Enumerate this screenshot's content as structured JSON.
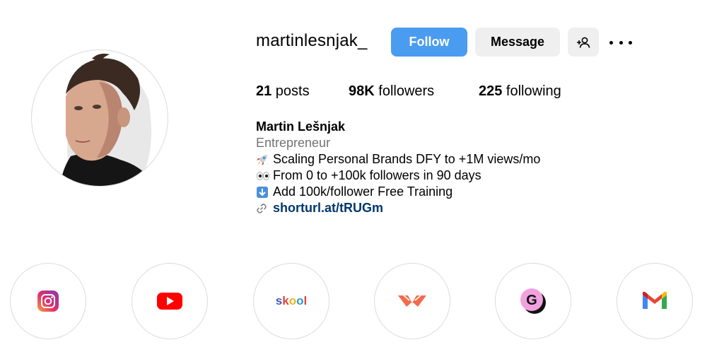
{
  "profile": {
    "username": "martinlesnjak_",
    "avatar_icon": "profile-photo"
  },
  "actions": {
    "follow_label": "Follow",
    "message_label": "Message",
    "add_user_icon": "add-user-icon",
    "more_icon": "more-options-icon"
  },
  "stats": {
    "posts_count": "21",
    "posts_label": " posts",
    "followers_count": "98K",
    "followers_label": " followers",
    "following_count": "225",
    "following_label": " following"
  },
  "bio": {
    "name": "Martin Lešnjak",
    "category": "Entrepreneur",
    "lines": [
      {
        "emoji": "rocket-emoji",
        "text": "Scaling Personal Brands DFY to +1M views/mo"
      },
      {
        "emoji": "eyes-emoji",
        "text": "From 0 to +100k followers in 90 days"
      },
      {
        "emoji": "down-arrow-emoji",
        "text": "Add 100k/follower Free Training"
      }
    ],
    "link": "shorturl.at/tRUGm"
  },
  "highlights": [
    {
      "icon": "instagram-icon"
    },
    {
      "icon": "youtube-icon"
    },
    {
      "icon": "skool-logo",
      "text": "skool"
    },
    {
      "icon": "winged-logo-icon"
    },
    {
      "icon": "g-logo-icon",
      "text": "G"
    },
    {
      "icon": "gmail-icon"
    }
  ],
  "colors": {
    "follow_button": "#4a9cf0",
    "secondary_button": "#efefef",
    "link": "#00376b",
    "muted_text": "#737373"
  }
}
